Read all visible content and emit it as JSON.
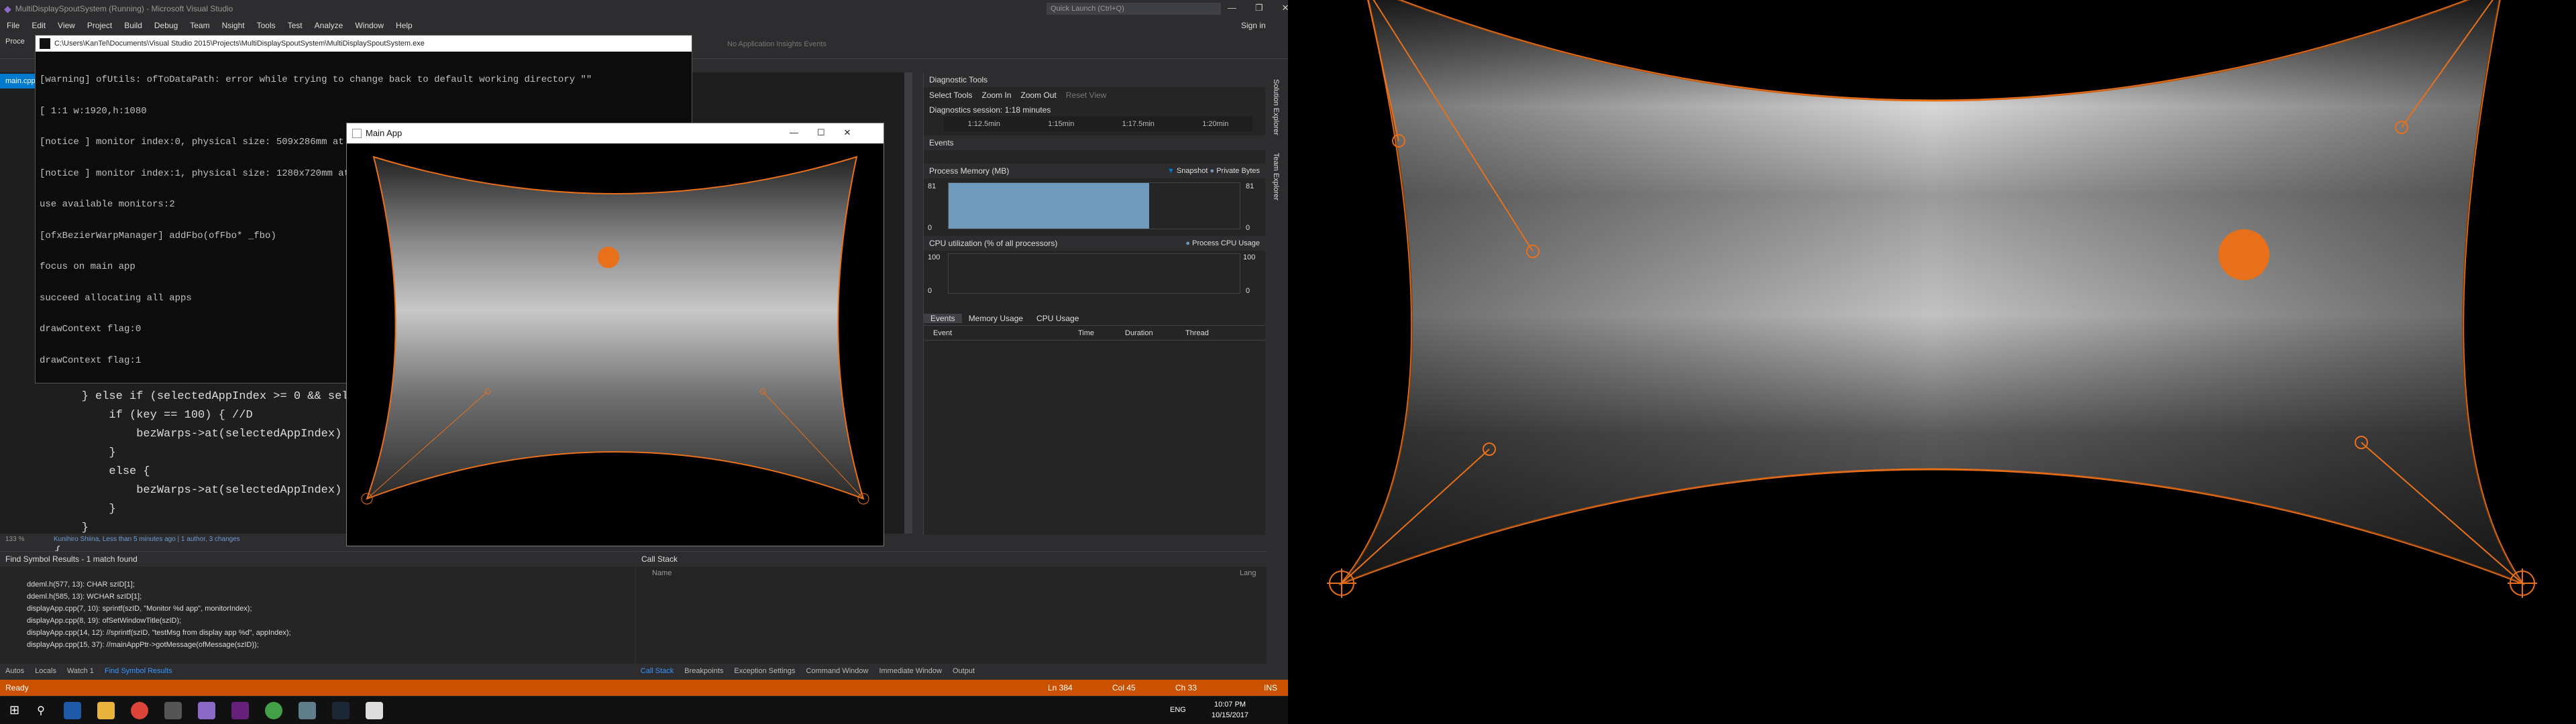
{
  "vs": {
    "window_title": "MultiDisplaySpoutSystem (Running) - Microsoft Visual Studio",
    "quick_launch": "Quick Launch (Ctrl+Q)",
    "sign_in": "Sign in",
    "menu": [
      "File",
      "Edit",
      "View",
      "Project",
      "Build",
      "Debug",
      "Team",
      "Nsight",
      "Tools",
      "Test",
      "Analyze",
      "Window",
      "Help"
    ],
    "toolbar_label": "Proce",
    "doc_tab": "main.cpp",
    "app_insights": "No Application Insights Events",
    "code_lines": [
      "        } else if (selectedAppIndex >= 0 && sele",
      "            if (key == 100) { //D",
      "                bezWarps->at(selectedAppIndex)",
      "            }",
      "            else {",
      "                bezWarps->at(selectedAppIndex)",
      "            }",
      "        }",
      "    }"
    ],
    "zoom": "133 %",
    "editor_info": "Kunihiro Shiina, Less than 5 minutes ago | 1 author, 3 changes"
  },
  "console": {
    "title": "C:\\Users\\KanTel\\Documents\\Visual Studio 2015\\Projects\\MultiDisplaySpoutSystem\\MultiDisplaySpoutSystem.exe",
    "lines": [
      "[warning] ofUtils: ofToDataPath: error while trying to change back to default working directory \"\"",
      "[ 1:1 w:1920,h:1080",
      "[notice ] monitor index:0, physical size: 509x286mm at 0, 0",
      "[notice ] monitor index:1, physical size: 1280x720mm at 1920, 0",
      "use available monitors:2",
      "[ofxBezierWarpManager] addFbo(ofFbo* _fbo)",
      "focus on main app",
      "succeed allocating all apps",
      "drawContext flag:0",
      "drawContext flag:1"
    ]
  },
  "main_app": {
    "title": "Main App"
  },
  "diag": {
    "panel_title": "Diagnostic Tools",
    "select_tools": "Select Tools",
    "zoom_in": "Zoom In",
    "zoom_out": "Zoom Out",
    "reset_view": "Reset View",
    "session": "Diagnostics session: 1:18 minutes",
    "timeline": [
      "1:12.5min",
      "1:15min",
      "1:17.5min",
      "1:20min"
    ],
    "events_header": "Events",
    "process_memory": "Process Memory (MB)",
    "snapshot": "Snapshot",
    "private_bytes": "Private Bytes",
    "mem_axis_top": "81",
    "mem_axis_bottom": "0",
    "cpu_header": "CPU utilization (% of all processors)",
    "cpu_legend": "Process CPU Usage",
    "cpu_axis_top": "100",
    "cpu_axis_bottom": "0",
    "tabs": [
      "Events",
      "Memory Usage",
      "CPU Usage"
    ],
    "columns": [
      "Event",
      "Time",
      "Duration",
      "Thread"
    ],
    "side_tabs": [
      "Solution Explorer",
      "Team Explorer"
    ],
    "colors": {
      "memory": "#6e9bbd",
      "accent": "#007acc"
    }
  },
  "find_panel": {
    "title": "Find Symbol Results - 1 match found",
    "results": [
      "ddeml.h(577, 13): CHAR szID[1];",
      "ddeml.h(585, 13): WCHAR szID[1];",
      "displayApp.cpp(7, 10): sprintf(szID, \"Monitor %d app\", monitorIndex);",
      "displayApp.cpp(8, 19): ofSetWindowTitle(szID);",
      "displayApp.cpp(14, 12): //sprintf(szID, \"testMsg from display app %d\", appIndex);",
      "displayApp.cpp(15, 37): //mainAppPtr->gotMessage(ofMessage(szID));"
    ]
  },
  "call_stack": {
    "title": "Call Stack",
    "columns": [
      "Name",
      "Lang"
    ]
  },
  "bottom_tabs_left": [
    "Autos",
    "Locals",
    "Watch 1",
    "Find Symbol Results"
  ],
  "bottom_tabs_right": [
    "Call Stack",
    "Breakpoints",
    "Exception Settings",
    "Command Window",
    "Immediate Window",
    "Output"
  ],
  "status": {
    "ready": "Ready",
    "ln": "Ln 384",
    "col": "Col 45",
    "ch": "Ch 33",
    "ins": "INS"
  },
  "taskbar": {
    "lang": "ENG",
    "time": "10:07 PM",
    "date": "10/15/2017"
  }
}
